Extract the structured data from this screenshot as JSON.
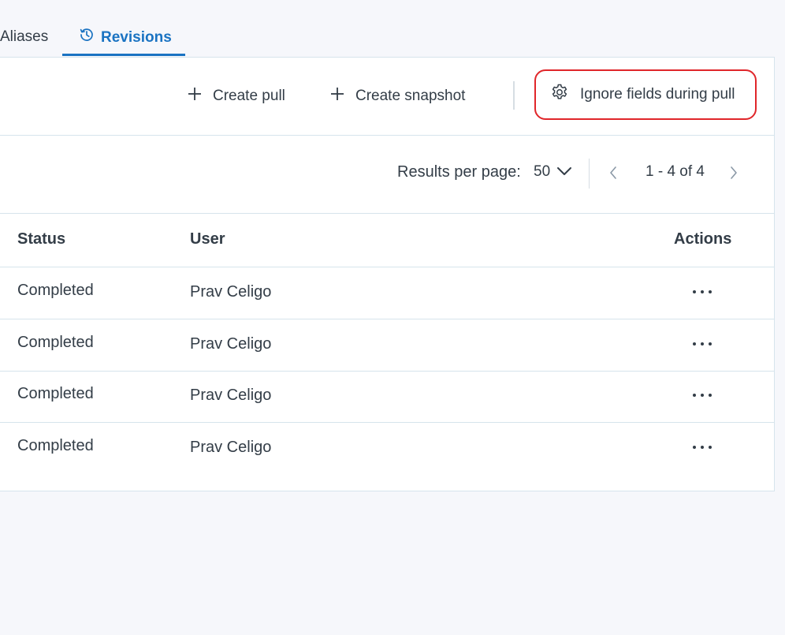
{
  "tabs": {
    "aliases": "Aliases",
    "revisions": "Revisions",
    "revisions_icon": "history-icon"
  },
  "toolbar": {
    "create_pull": "Create pull",
    "create_snapshot": "Create snapshot",
    "ignore_fields": "Ignore fields during pull",
    "highlight_color": "#e0262a"
  },
  "pagination": {
    "results_per_page_label": "Results per page:",
    "results_per_page_value": "50",
    "range": "1 - 4 of 4"
  },
  "table": {
    "headers": {
      "status": "Status",
      "user": "User",
      "actions": "Actions"
    },
    "rows": [
      {
        "status": "Completed",
        "user": "Prav Celigo"
      },
      {
        "status": "Completed",
        "user": "Prav Celigo"
      },
      {
        "status": "Completed",
        "user": "Prav Celigo"
      },
      {
        "status": "Completed",
        "user": "Prav Celigo"
      }
    ]
  },
  "colors": {
    "accent": "#1a73c2",
    "text": "#333d47",
    "border": "#d6e4ec",
    "background": "#f6f7fb"
  }
}
